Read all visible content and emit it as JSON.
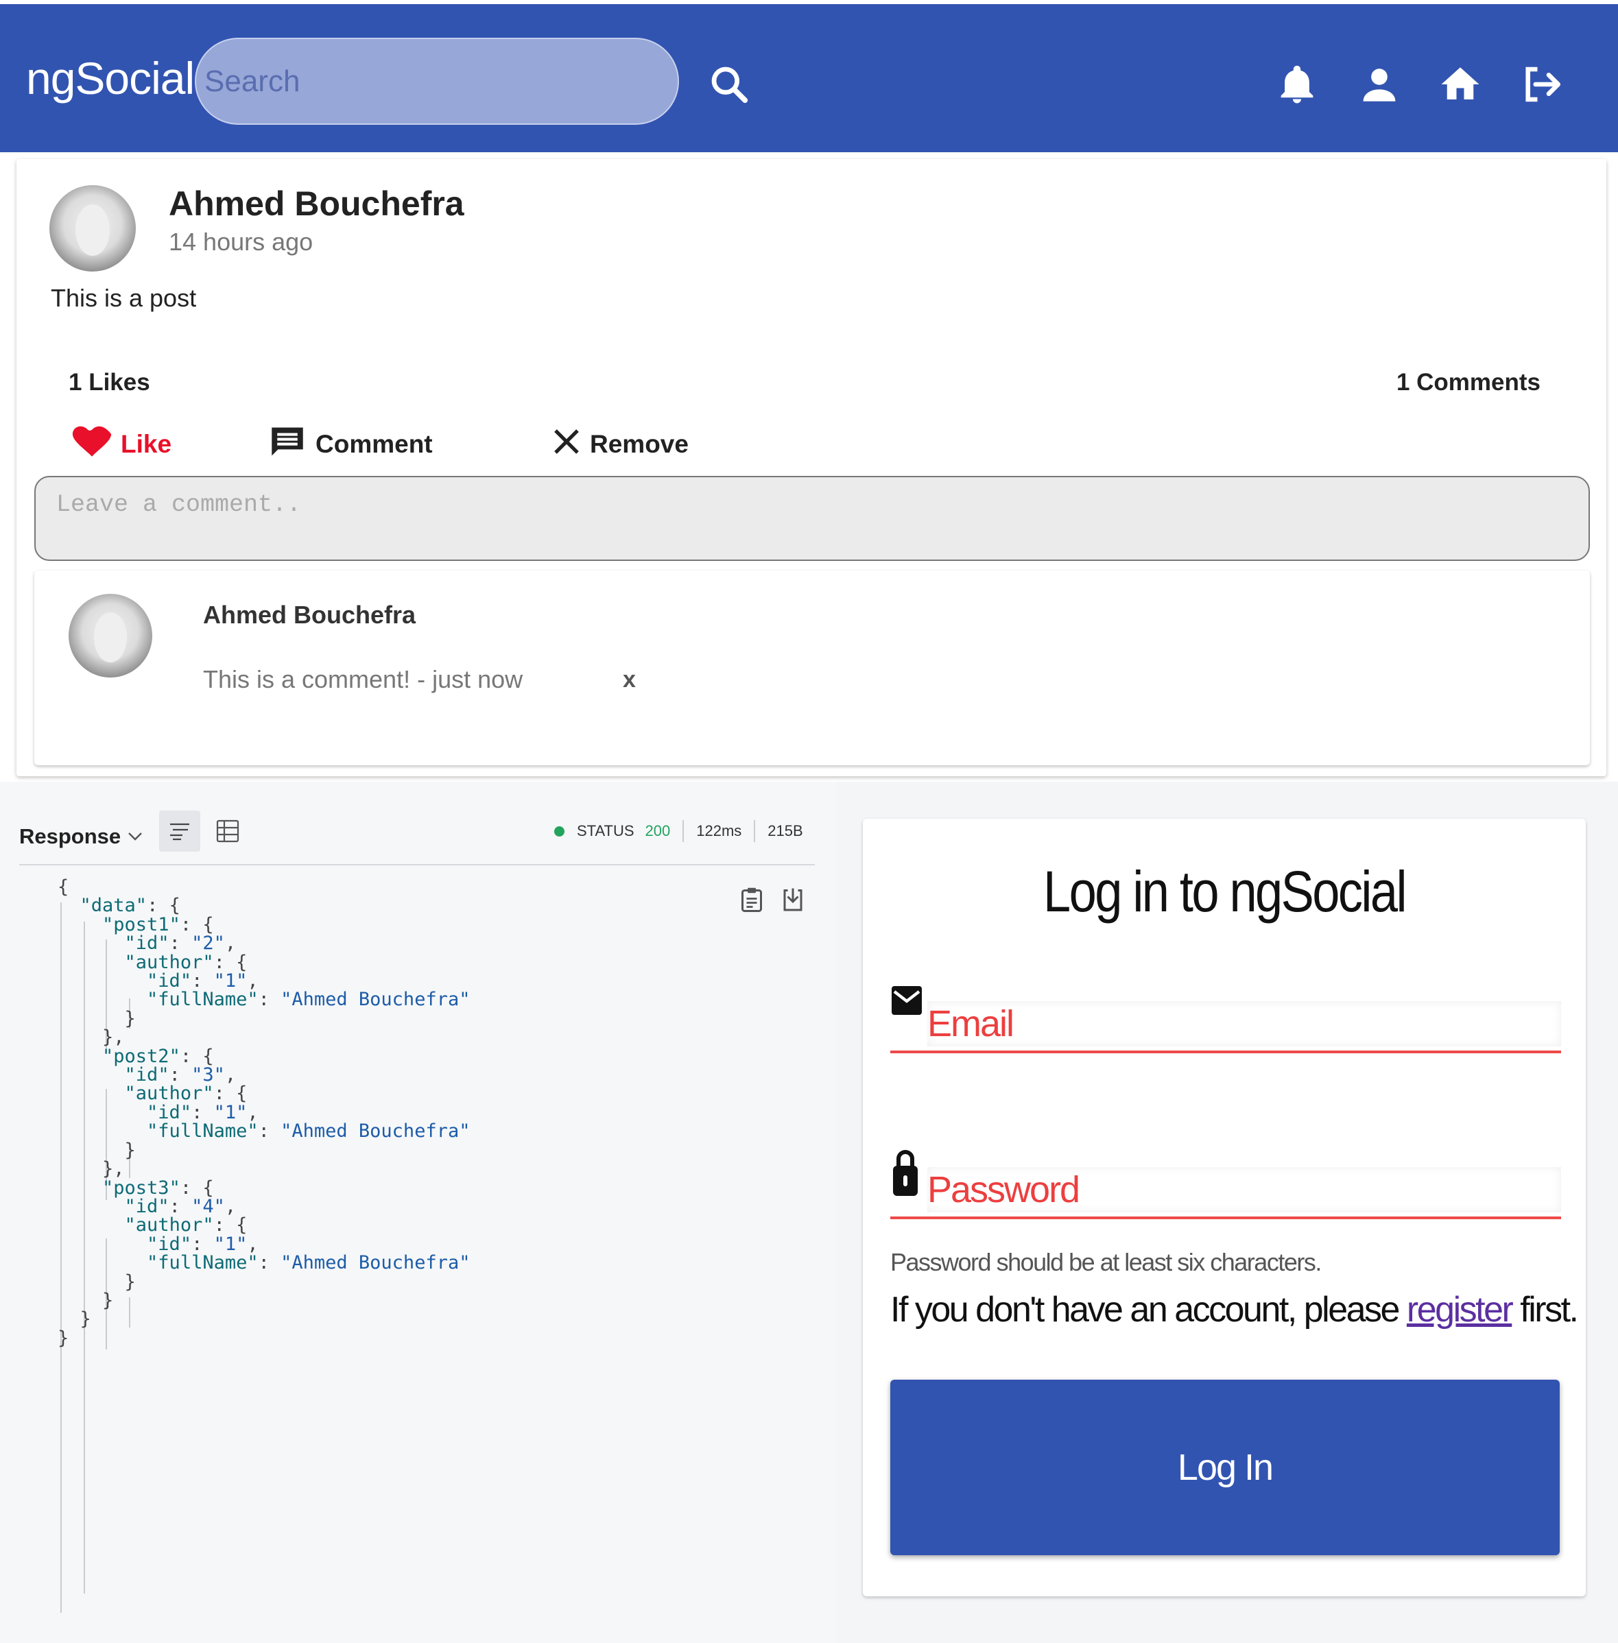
{
  "navbar": {
    "brand": "ngSocial",
    "search_placeholder": "Search",
    "icons": [
      "search-icon",
      "bell-icon",
      "person-icon",
      "home-icon",
      "logout-icon"
    ]
  },
  "post": {
    "author": "Ahmed Bouchefra",
    "time": "14 hours ago",
    "body": "This is a post",
    "likes": "1 Likes",
    "comments": "1 Comments",
    "actions": {
      "like": "Like",
      "comment": "Comment",
      "remove": "Remove"
    },
    "comment_placeholder": "Leave a comment..",
    "comment_list": [
      {
        "author": "Ahmed Bouchefra",
        "text": "This is a comment! - just now",
        "delete": "x"
      }
    ]
  },
  "response": {
    "title": "Response",
    "status_label": "STATUS",
    "status_code": "200",
    "time": "122ms",
    "size": "215B"
  },
  "login": {
    "title": "Log in to ngSocial",
    "email_placeholder": "Email",
    "password_placeholder": "Password",
    "password_hint": "Password should be at least six characters.",
    "register_prefix": "If you don't have an account, please ",
    "register_link": "register",
    "register_suffix": " first.",
    "submit": "Log In"
  },
  "colors": {
    "primary": "#3254b1",
    "like": "#e8102a",
    "error": "#ee4a4a",
    "status_ok": "#22a45d"
  }
}
